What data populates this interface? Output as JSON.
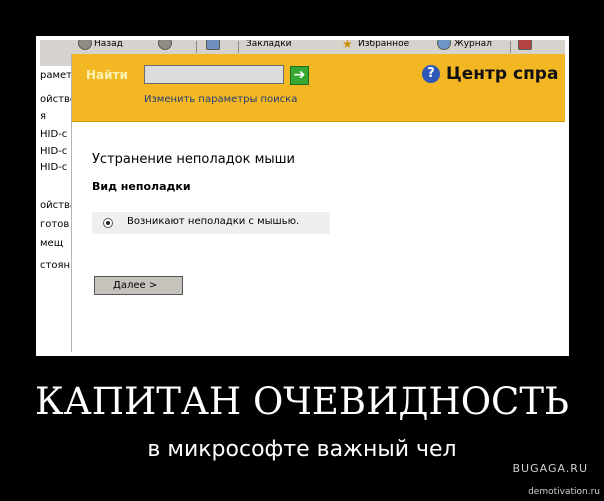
{
  "toolbar": {
    "back_label": "Назад",
    "favorites_label": "Избранное",
    "bookmarks_label": "Закладки",
    "journal_label": "Журнал"
  },
  "sidebar": {
    "items": [
      "раметр",
      "ойстве",
      "я",
      "HID-с",
      "HID-с",
      "HID-с",
      "ойства",
      "готов",
      "мещ",
      "стоян"
    ]
  },
  "search": {
    "find_label": "Найти",
    "value": "",
    "change_link": "Изменить параметры поиска"
  },
  "help_center": {
    "icon": "question-icon",
    "title": "Центр спра"
  },
  "main": {
    "heading": "Устранение неполадок мыши",
    "problem_type_label": "Вид неполадки",
    "option_label": "Возникают неполадки с мышью.",
    "option_selected": true,
    "next_button": "Далее  >"
  },
  "poster": {
    "title": "КАПИТАН ОЧЕВИДНОСТЬ",
    "subtitle": "в микрософте важный чел",
    "watermark": "BUGAGA.RU",
    "site": "demotivation.ru"
  },
  "colors": {
    "header_bg": "#f2b722",
    "go_button": "#35a832",
    "link": "#223c7a"
  }
}
